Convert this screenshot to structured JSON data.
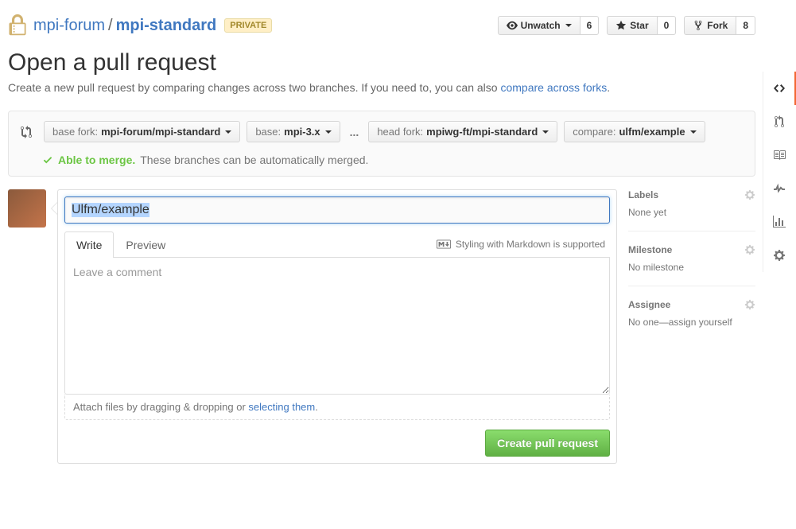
{
  "repo": {
    "owner": "mpi-forum",
    "name": "mpi-standard",
    "private_badge": "PRIVATE"
  },
  "actions": {
    "unwatch": {
      "label": "Unwatch",
      "count": "6"
    },
    "star": {
      "label": "Star",
      "count": "0"
    },
    "fork": {
      "label": "Fork",
      "count": "8"
    }
  },
  "page": {
    "title": "Open a pull request",
    "subheading": "Create a new pull request by comparing changes across two branches. If you need to, you can also ",
    "compare_link": "compare across forks"
  },
  "range": {
    "base_fork_label": "base fork:",
    "base_fork_value": "mpi-forum/mpi-standard",
    "base_label": "base:",
    "base_value": "mpi-3.x",
    "dots": "...",
    "head_fork_label": "head fork:",
    "head_fork_value": "mpiwg-ft/mpi-standard",
    "compare_label": "compare:",
    "compare_value": "ulfm/example"
  },
  "merge": {
    "status": "Able to merge.",
    "text": "These branches can be automatically merged."
  },
  "form": {
    "title_value": "Ulfm/example",
    "write_tab": "Write",
    "preview_tab": "Preview",
    "markdown_hint": "Styling with Markdown is supported",
    "comment_placeholder": "Leave a comment",
    "attach_text": "Attach files by dragging & dropping or ",
    "attach_link": "selecting them",
    "submit": "Create pull request"
  },
  "sidebar": {
    "labels": {
      "title": "Labels",
      "value": "None yet"
    },
    "milestone": {
      "title": "Milestone",
      "value": "No milestone"
    },
    "assignee": {
      "title": "Assignee",
      "value": "No one—assign yourself"
    }
  }
}
